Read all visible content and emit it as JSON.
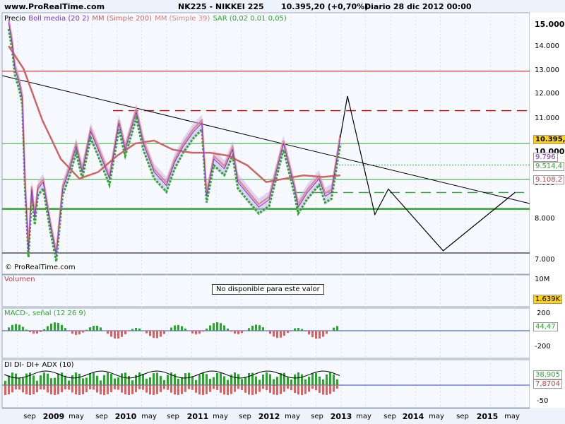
{
  "header": {
    "site": "www.ProRealTime.com",
    "instrument": "NK225 - NIKKEI 225",
    "last": "10.395,20 (+0,70%)",
    "period": "Diario  28 dic 2012 00:00"
  },
  "copyright": "© ProRealTime.com",
  "colors": {
    "price_up": "#28a828",
    "price_down": "#e06060",
    "ma200": "#d06464",
    "ma39": "#e08080",
    "boll": "#7d2fd0",
    "boll_band": "#c8b4f0",
    "trend": "#000000",
    "resistance_red": "#cc0000",
    "support_green": "#2ea52e"
  },
  "chart_data": [
    {
      "type": "line",
      "panel": "Precio",
      "legend": [
        "Precio",
        "Boll media (20 2)",
        "MM (Simple 200)",
        "MM (Simple 39)",
        "SAR (0,02 0,01 0,05)"
      ],
      "y_ticks": [
        "15.000",
        "14.000",
        "13.000",
        "12.000",
        "11.000",
        "10.000",
        "9.000",
        "8.000",
        "7.000"
      ],
      "ylim": [
        6800,
        15300
      ],
      "scale": "log",
      "price_path": [
        [
          "2008-07-20",
          15100
        ],
        [
          "2008-08-05",
          14200
        ],
        [
          "2008-08-20",
          13000
        ],
        [
          "2008-09-10",
          12400
        ],
        [
          "2008-09-25",
          11800
        ],
        [
          "2008-10-08",
          9000
        ],
        [
          "2008-10-25",
          7200
        ],
        [
          "2008-11-10",
          8800
        ],
        [
          "2008-11-25",
          8000
        ],
        [
          "2008-12-10",
          8800
        ],
        [
          "2009-01-05",
          9000
        ],
        [
          "2009-02-10",
          7800
        ],
        [
          "2009-03-10",
          7100
        ],
        [
          "2009-04-10",
          8800
        ],
        [
          "2009-05-15",
          9400
        ],
        [
          "2009-06-15",
          10100
        ],
        [
          "2009-07-15",
          9300
        ],
        [
          "2009-08-25",
          10600
        ],
        [
          "2009-10-01",
          10000
        ],
        [
          "2009-11-25",
          9100
        ],
        [
          "2010-01-10",
          10900
        ],
        [
          "2010-02-10",
          10000
        ],
        [
          "2010-04-05",
          11300
        ],
        [
          "2010-05-10",
          10200
        ],
        [
          "2010-07-01",
          9300
        ],
        [
          "2010-08-31",
          8900
        ],
        [
          "2010-10-10",
          9600
        ],
        [
          "2010-11-20",
          10100
        ],
        [
          "2011-01-10",
          10600
        ],
        [
          "2011-02-20",
          10900
        ],
        [
          "2011-03-15",
          8600
        ],
        [
          "2011-04-20",
          9700
        ],
        [
          "2011-06-10",
          9400
        ],
        [
          "2011-07-20",
          10000
        ],
        [
          "2011-08-15",
          9000
        ],
        [
          "2011-11-25",
          8300
        ],
        [
          "2012-01-15",
          8500
        ],
        [
          "2012-03-25",
          10200
        ],
        [
          "2012-05-15",
          8900
        ],
        [
          "2012-06-05",
          8300
        ],
        [
          "2012-07-20",
          8700
        ],
        [
          "2012-09-15",
          9100
        ],
        [
          "2012-10-15",
          8600
        ],
        [
          "2012-11-15",
          8700
        ],
        [
          "2012-12-28",
          10395
        ]
      ],
      "ma200_path": [
        [
          "2008-07-20",
          14000
        ],
        [
          "2008-10-01",
          13000
        ],
        [
          "2009-01-01",
          11000
        ],
        [
          "2009-04-01",
          9700
        ],
        [
          "2009-07-01",
          9100
        ],
        [
          "2009-10-01",
          9300
        ],
        [
          "2010-01-01",
          9800
        ],
        [
          "2010-04-01",
          10200
        ],
        [
          "2010-07-01",
          10300
        ],
        [
          "2010-10-01",
          10000
        ],
        [
          "2011-01-01",
          9900
        ],
        [
          "2011-04-01",
          9900
        ],
        [
          "2011-07-01",
          9800
        ],
        [
          "2011-10-01",
          9500
        ],
        [
          "2012-01-01",
          9000
        ],
        [
          "2012-04-01",
          9100
        ],
        [
          "2012-07-01",
          9200
        ],
        [
          "2012-10-01",
          9150
        ],
        [
          "2012-12-28",
          9200
        ]
      ],
      "value_labels": [
        "10.395,2",
        "9.796",
        "9.514,4",
        "9.108,2"
      ],
      "resistance_dashed": 11350,
      "horizontal_lines": [
        12900,
        10200,
        9080,
        8250,
        7150
      ],
      "support_dashed": 8700,
      "projection_path": [
        [
          "2012-12-28",
          10400
        ],
        [
          "2013-02-01",
          11900
        ],
        [
          "2013-06-15",
          8100
        ],
        [
          "2013-08-20",
          8800
        ],
        [
          "2014-05-15",
          7200
        ],
        [
          "2015-05-01",
          8700
        ]
      ]
    },
    {
      "type": "bar",
      "panel": "Volumen",
      "title": "Volumen",
      "y_ticks": [
        "10M"
      ],
      "value_label": "1.639K",
      "message": "No disponible para este valor"
    },
    {
      "type": "bar",
      "panel": "MACD",
      "title": "MACD-, señal (12 26 9)",
      "y_ticks": [
        "200",
        "-200"
      ],
      "value_label": "44,47"
    },
    {
      "type": "bar",
      "panel": "DMI",
      "title": "DI DI- DI+ ADX (10)",
      "y_ticks": [
        "-50"
      ],
      "value_labels": [
        "38,905",
        "7,8704"
      ]
    }
  ],
  "x_axis": {
    "months": [
      "sep",
      "may",
      "sep",
      "may",
      "sep",
      "may",
      "sep",
      "may",
      "sep",
      "may",
      "sep",
      "may",
      "sep",
      "may"
    ],
    "years": [
      "2009",
      "2010",
      "2011",
      "2012",
      "2013",
      "2014",
      "2015"
    ]
  }
}
